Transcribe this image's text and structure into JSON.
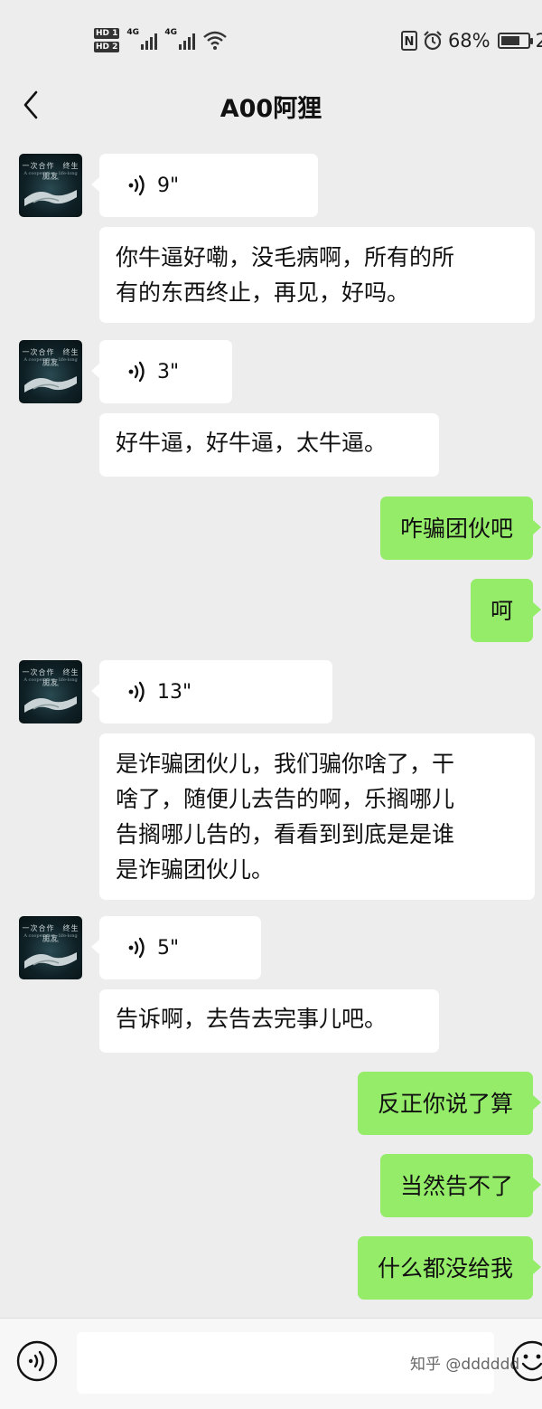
{
  "status_bar": {
    "sim1": "HD 1",
    "sim2": "HD 2",
    "network1": "4G",
    "network2": "4G",
    "battery_percent": "68%",
    "clock_partial": "2",
    "icons": [
      "nfc-icon",
      "alarm-icon",
      "battery-icon",
      "wifi-icon",
      "signal-icon"
    ]
  },
  "header": {
    "title": "A00阿狸",
    "back_icon": "chevron-left-icon"
  },
  "avatar": {
    "caption": "一次合作　终生朋友",
    "subcaption": "A cooperation, life-long friends"
  },
  "messages": [
    {
      "id": "m1",
      "side": "left",
      "type": "voice",
      "duration": "9\""
    },
    {
      "id": "m2",
      "side": "left",
      "type": "text",
      "lines": [
        "你牛逼好嘞，没毛病啊，所有的所",
        "有的东西终止，再见，好吗。"
      ]
    },
    {
      "id": "m3",
      "side": "left",
      "type": "voice",
      "duration": "3\""
    },
    {
      "id": "m4",
      "side": "left",
      "type": "text",
      "lines": [
        "好牛逼，好牛逼，太牛逼。"
      ]
    },
    {
      "id": "m5",
      "side": "right",
      "type": "text",
      "text": "咋骗团伙吧"
    },
    {
      "id": "m6",
      "side": "right",
      "type": "text",
      "text": "呵"
    },
    {
      "id": "m7",
      "side": "left",
      "type": "voice",
      "duration": "13\""
    },
    {
      "id": "m8",
      "side": "left",
      "type": "text",
      "lines": [
        "是诈骗团伙儿，我们骗你啥了，干",
        "啥了，随便儿去告的啊，乐搁哪儿",
        "告搁哪儿告的，看看到到底是是谁",
        "是诈骗团伙儿。"
      ]
    },
    {
      "id": "m9",
      "side": "left",
      "type": "voice",
      "duration": "5\""
    },
    {
      "id": "m10",
      "side": "left",
      "type": "text",
      "lines": [
        "告诉啊，去告去完事儿吧。"
      ]
    },
    {
      "id": "m11",
      "side": "right",
      "type": "text",
      "text": "反正你说了算"
    },
    {
      "id": "m12",
      "side": "right",
      "type": "text",
      "text": "当然告不了"
    },
    {
      "id": "m13",
      "side": "right",
      "type": "text",
      "text": "什么都没给我"
    }
  ],
  "input_bar": {
    "value": "",
    "voice_icon": "voice-toggle-icon",
    "emoji_icon": "emoji-icon",
    "watermark": "知乎 @dddddd"
  },
  "colors": {
    "background": "#ededed",
    "my_bubble": "#95ec69",
    "their_bubble": "#ffffff",
    "input_bar": "#f7f7f7"
  }
}
